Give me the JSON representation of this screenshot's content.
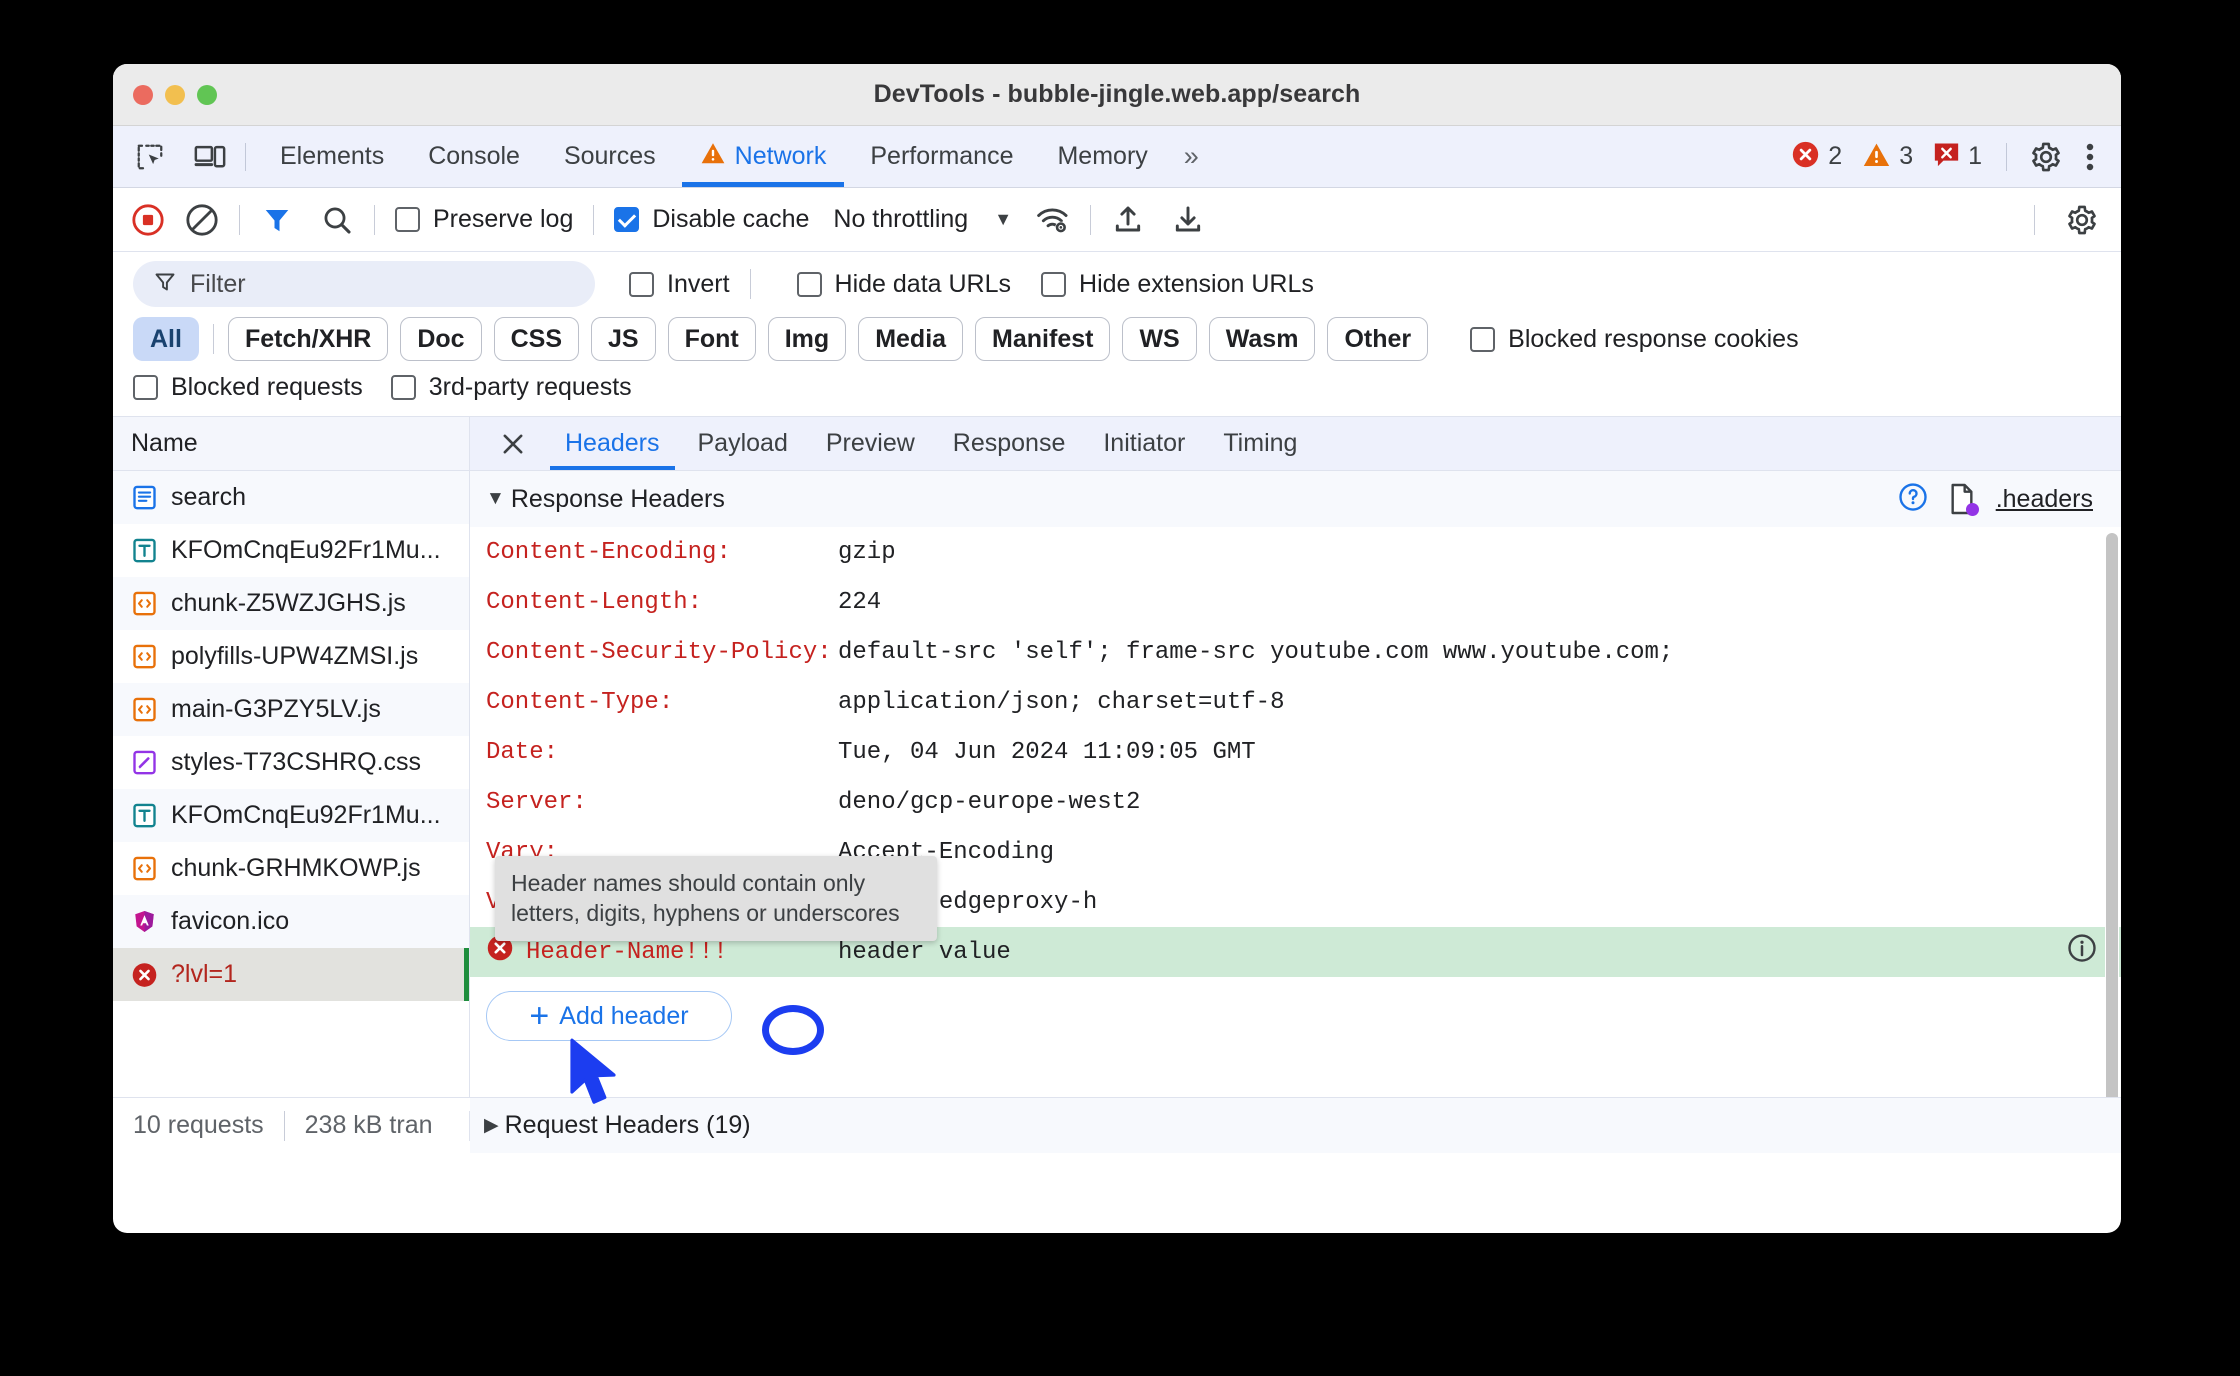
{
  "window": {
    "title": "DevTools - bubble-jingle.web.app/search"
  },
  "tabbar": {
    "inspect_icon": "inspect-element-icon",
    "device_icon": "device-toolbar-icon",
    "tabs": [
      {
        "label": "Elements",
        "active": false,
        "warn": false
      },
      {
        "label": "Console",
        "active": false,
        "warn": false
      },
      {
        "label": "Sources",
        "active": false,
        "warn": false
      },
      {
        "label": "Network",
        "active": true,
        "warn": true
      },
      {
        "label": "Performance",
        "active": false,
        "warn": false
      },
      {
        "label": "Memory",
        "active": false,
        "warn": false
      }
    ],
    "more_label": "»",
    "counts": {
      "errors": "2",
      "warnings": "3",
      "issues": "1"
    },
    "settings_icon": "gear-icon",
    "menu_icon": "kebab-menu-icon"
  },
  "network_toolbar": {
    "record_icon": "record-stop-icon",
    "clear_icon": "clear-icon",
    "filter_icon": "filter-icon",
    "search_icon": "search-icon",
    "preserve_log": {
      "label": "Preserve log",
      "checked": false
    },
    "disable_cache": {
      "label": "Disable cache",
      "checked": true
    },
    "throttling": {
      "value": "No throttling",
      "caret": "▼"
    },
    "network_conditions_icon": "wifi-settings-icon",
    "import_icon": "upload-har-icon",
    "export_icon": "download-har-icon",
    "settings_icon": "network-settings-gear-icon"
  },
  "filterbar": {
    "filter_placeholder": "Filter",
    "invert": {
      "label": "Invert",
      "checked": false
    },
    "hide_data_urls": {
      "label": "Hide data URLs",
      "checked": false
    },
    "hide_extension_urls": {
      "label": "Hide extension URLs",
      "checked": false
    },
    "types": [
      {
        "label": "All",
        "selected": true
      },
      {
        "label": "Fetch/XHR",
        "selected": false
      },
      {
        "label": "Doc",
        "selected": false
      },
      {
        "label": "CSS",
        "selected": false
      },
      {
        "label": "JS",
        "selected": false
      },
      {
        "label": "Font",
        "selected": false
      },
      {
        "label": "Img",
        "selected": false
      },
      {
        "label": "Media",
        "selected": false
      },
      {
        "label": "Manifest",
        "selected": false
      },
      {
        "label": "WS",
        "selected": false
      },
      {
        "label": "Wasm",
        "selected": false
      },
      {
        "label": "Other",
        "selected": false
      }
    ],
    "blocked_response_cookies": {
      "label": "Blocked response cookies",
      "checked": false
    },
    "blocked_requests": {
      "label": "Blocked requests",
      "checked": false
    },
    "third_party_requests": {
      "label": "3rd-party requests",
      "checked": false
    }
  },
  "request_list": {
    "column_header": "Name",
    "rows": [
      {
        "name": "search",
        "icon": "document-icon",
        "selected": false
      },
      {
        "name": "KFOmCnqEu92Fr1Mu...",
        "icon": "font-icon",
        "selected": false
      },
      {
        "name": "chunk-Z5WZJGHS.js",
        "icon": "script-icon",
        "selected": false
      },
      {
        "name": "polyfills-UPW4ZMSI.js",
        "icon": "script-icon",
        "selected": false
      },
      {
        "name": "main-G3PZY5LV.js",
        "icon": "script-icon",
        "selected": false
      },
      {
        "name": "styles-T73CSHRQ.css",
        "icon": "stylesheet-icon",
        "selected": false
      },
      {
        "name": "KFOmCnqEu92Fr1Mu...",
        "icon": "font-icon",
        "selected": false
      },
      {
        "name": "chunk-GRHMKOWP.js",
        "icon": "script-icon",
        "selected": false
      },
      {
        "name": "favicon.ico",
        "icon": "angular-favicon-icon",
        "selected": false
      },
      {
        "name": "?lvl=1",
        "icon": "error-icon",
        "selected": true
      }
    ]
  },
  "detail": {
    "close_icon": "close-icon",
    "tabs": [
      {
        "label": "Headers",
        "active": true
      },
      {
        "label": "Payload",
        "active": false
      },
      {
        "label": "Preview",
        "active": false
      },
      {
        "label": "Response",
        "active": false
      },
      {
        "label": "Initiator",
        "active": false
      },
      {
        "label": "Timing",
        "active": false
      }
    ],
    "response_section": {
      "triangle": "▼",
      "title": "Response Headers",
      "help_icon": "help-question-icon",
      "file_icon": "headers-file-icon",
      "link_label": ".headers"
    },
    "headers": [
      {
        "name": "Content-Encoding:",
        "value": "gzip",
        "error": false
      },
      {
        "name": "Content-Length:",
        "value": "224",
        "error": false
      },
      {
        "name": "Content-Security-Policy:",
        "value": "default-src 'self'; frame-src youtube.com www.youtube.com;",
        "error": false
      },
      {
        "name": "Content-Type:",
        "value": "application/json; charset=utf-8",
        "error": false
      },
      {
        "name": "Date:",
        "value": "Tue, 04 Jun 2024 11:09:05 GMT",
        "error": false
      },
      {
        "name": "Server:",
        "value": "deno/gcp-europe-west2",
        "error": false
      },
      {
        "name": "Vary:",
        "value": "Accept-Encoding",
        "error": false
      },
      {
        "name": "Via:",
        "value": "http/2 edgeproxy-h",
        "error": false
      },
      {
        "name": "Header-Name!!!",
        "value": "header value",
        "error": true
      }
    ],
    "add_header_button": "Add header",
    "add_header_plus": "+",
    "request_section": {
      "triangle": "▶",
      "title": "Request Headers (19)"
    }
  },
  "tooltip": {
    "text": "Header names should contain only letters, digits, hyphens or underscores"
  },
  "statusbar": {
    "requests": "10 requests",
    "transferred": "238 kB tran"
  },
  "annotation": {
    "circle_target": "!!!",
    "cursor": "mouse-cursor"
  },
  "colors": {
    "accent": "#1a73e8",
    "error": "#c5221f",
    "warning": "#e8710a",
    "success_row": "#ceead6",
    "header_name": "#c5221f",
    "annotation": "#1c3df0"
  }
}
